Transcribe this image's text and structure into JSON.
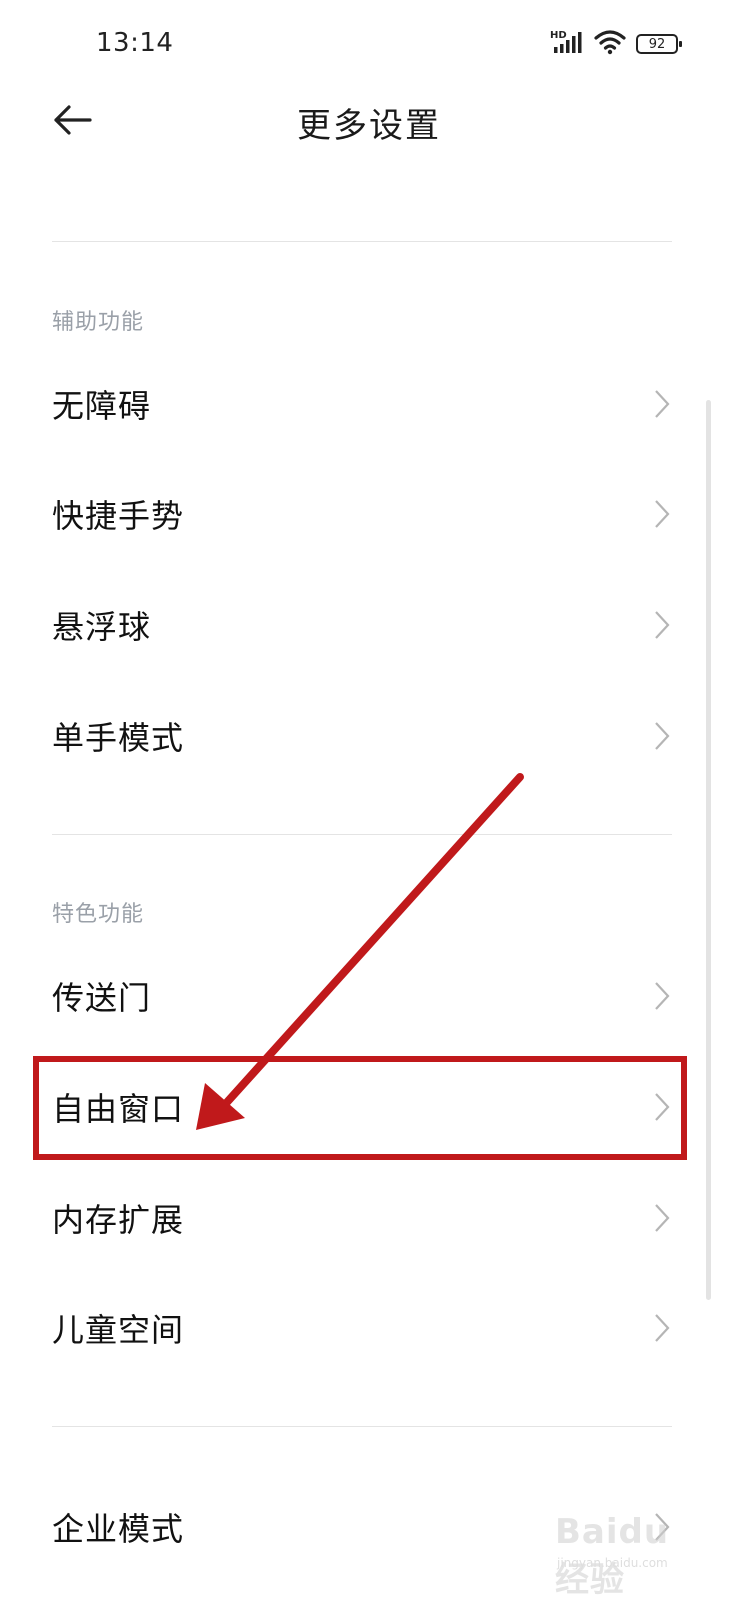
{
  "status_bar": {
    "time": "13:14",
    "network": "HD",
    "battery": "92",
    "icons": [
      "signal-icon",
      "wifi-icon",
      "battery-icon"
    ]
  },
  "header": {
    "title": "更多设置",
    "back_icon": "back-arrow-icon"
  },
  "sections": [
    {
      "label": "辅助功能",
      "items": [
        {
          "label": "无障碍"
        },
        {
          "label": "快捷手势"
        },
        {
          "label": "悬浮球"
        },
        {
          "label": "单手模式"
        }
      ]
    },
    {
      "label": "特色功能",
      "items": [
        {
          "label": "传送门"
        },
        {
          "label": "自由窗口"
        },
        {
          "label": "内存扩展"
        },
        {
          "label": "儿童空间"
        }
      ]
    },
    {
      "label": "",
      "items": [
        {
          "label": "企业模式"
        }
      ]
    }
  ],
  "annotation": {
    "highlight_color": "#c0191b",
    "highlighted_item": "自由窗口"
  },
  "watermark": {
    "logo": "Baidu经验",
    "sub": "jingyan.baidu.com"
  },
  "colors": {
    "text_primary": "#111111",
    "section_label": "#9aa0a8",
    "divider": "#e4e4e4",
    "chevron": "#b5b5b5"
  }
}
